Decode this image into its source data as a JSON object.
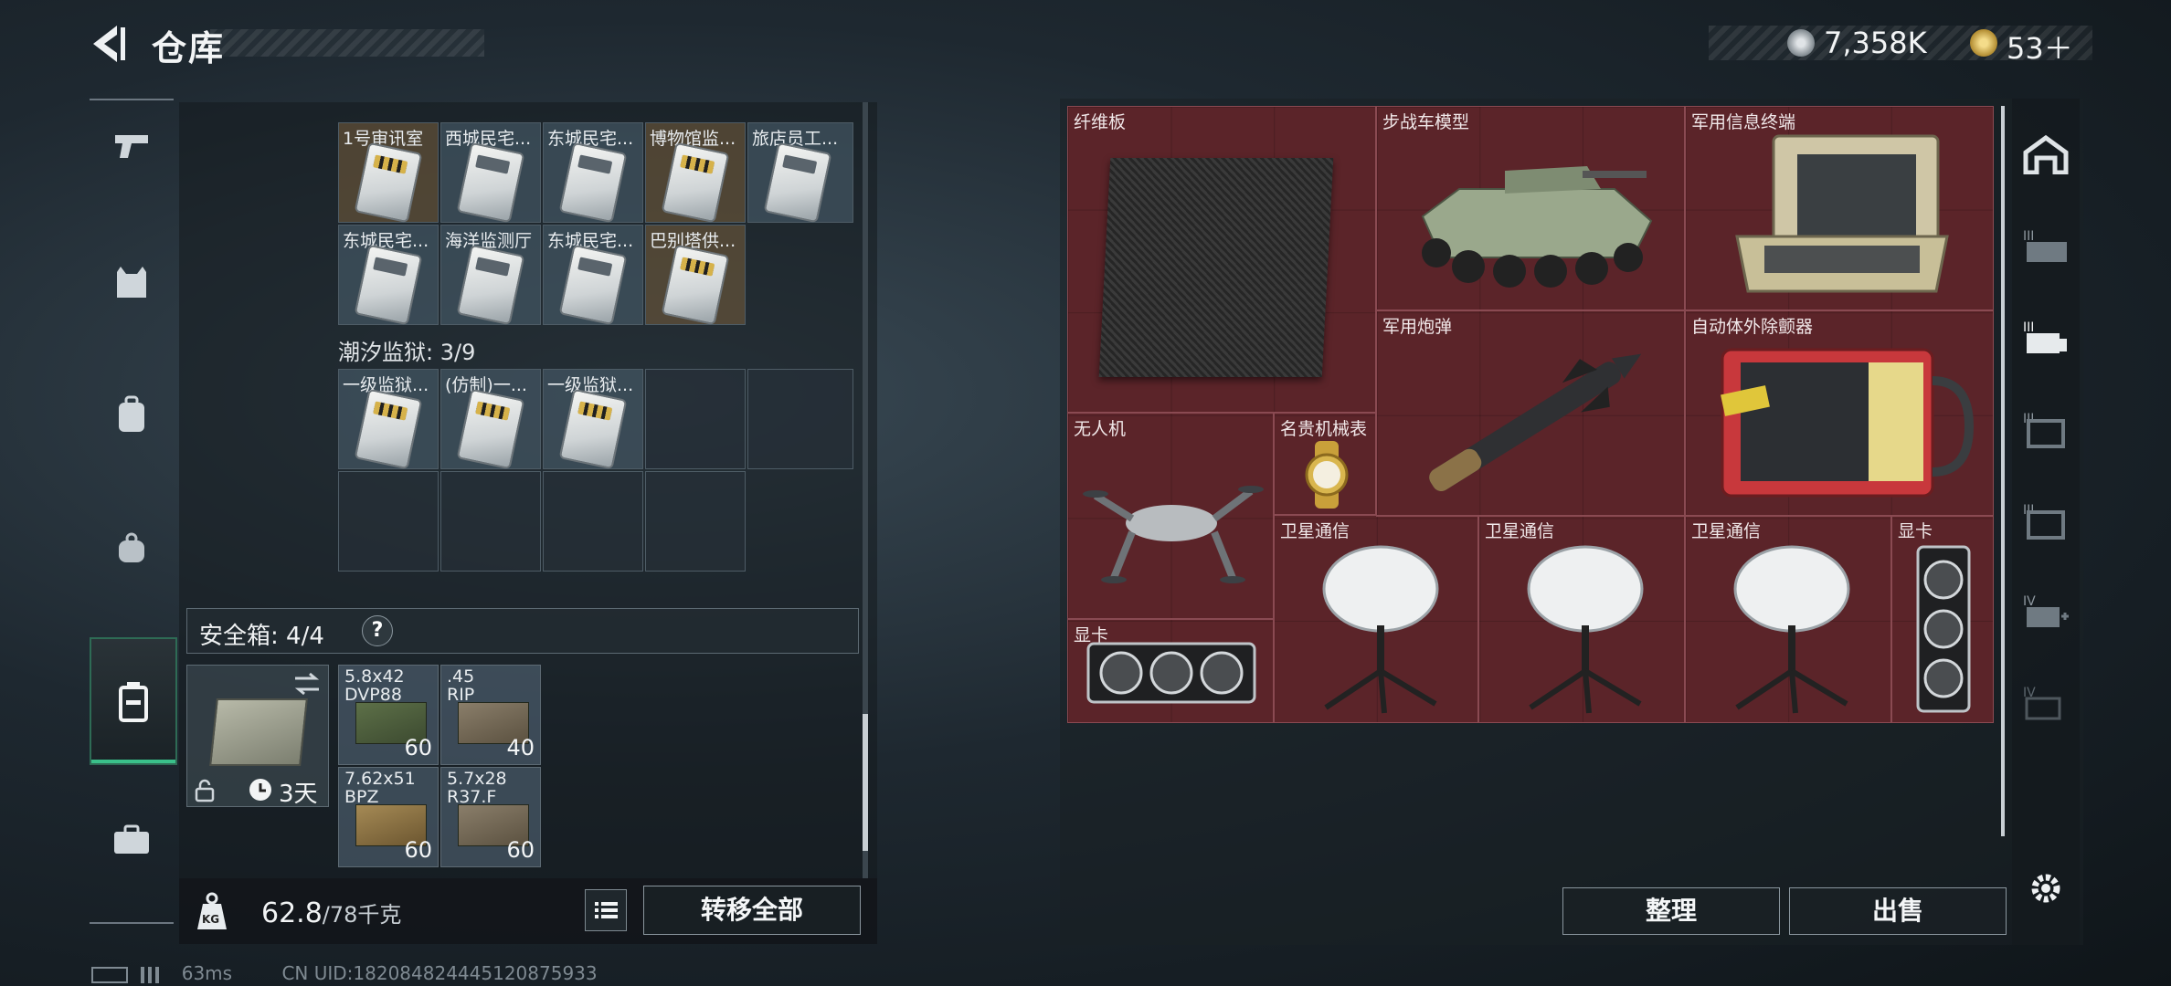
{
  "header": {
    "title": "仓库",
    "currency": "7,358K",
    "tickets": "53＋"
  },
  "sidebar": {
    "icons": [
      "pistol-icon",
      "vest-icon",
      "backpack-icon",
      "bag-icon",
      "container-icon",
      "toolbox-icon"
    ]
  },
  "left_panel": {
    "top_cells_row1": [
      "1号审讯室",
      "西城民宅...",
      "东城民宅...",
      "博物馆监...",
      "旅店员工..."
    ],
    "top_cells_row2": [
      "东城民宅...",
      "海洋监测厅",
      "东城民宅...",
      "巴别塔供..."
    ],
    "section2_title": "潮汐监狱: 3/9",
    "section2_cells": [
      "一级监狱...",
      "(仿制)一...",
      "一级监狱..."
    ],
    "safe_box": {
      "label": "安全箱: 4/4",
      "help": "?",
      "timer": "3天"
    },
    "ammo": [
      {
        "name": "5.8x42\nDVP88",
        "count": "60"
      },
      {
        "name": ".45\nRIP",
        "count": "40"
      },
      {
        "name": "7.62x51\nBPZ",
        "count": "60"
      },
      {
        "name": "5.7x28\nR37.F",
        "count": "60"
      }
    ],
    "weight": {
      "value": "62.8",
      "max": "/78千克"
    },
    "kg_label": "KG",
    "transfer_all": "转移全部"
  },
  "stash": {
    "items": [
      {
        "label": "纤维板"
      },
      {
        "label": "步战车模型"
      },
      {
        "label": "军用信息终端"
      },
      {
        "label": "军用炮弹"
      },
      {
        "label": "自动体外除颤器"
      },
      {
        "label": "无人机"
      },
      {
        "label": "名贵机械表"
      },
      {
        "label": "卫星通信"
      },
      {
        "label": "卫星通信"
      },
      {
        "label": "卫星通信"
      },
      {
        "label": "显卡"
      },
      {
        "label": "显卡"
      }
    ],
    "sort_button": "整理",
    "sell_button": "出售"
  },
  "right_sidebar": {
    "labels": [
      "III",
      "III",
      "III",
      "III",
      "IV",
      "IV"
    ]
  },
  "status": {
    "ping": "63ms",
    "uid": "CN UID:1820848244451208759​33"
  }
}
